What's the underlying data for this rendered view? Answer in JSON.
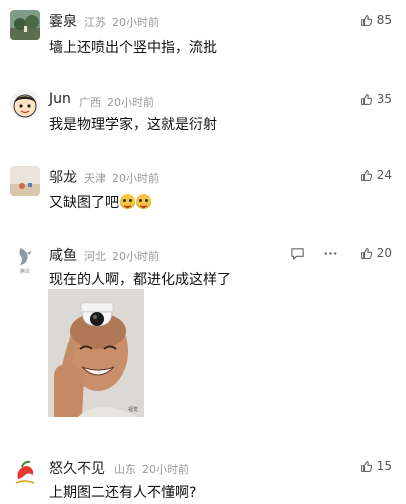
{
  "comments": [
    {
      "name": "霎泉",
      "region": "江苏",
      "time": "20小时前",
      "text": "墙上还喷出个竖中指，流批",
      "likes": "85"
    },
    {
      "name": "Jun",
      "region": "广西",
      "time": "20小时前",
      "text": "我是物理学家，这就是衍射",
      "likes": "35"
    },
    {
      "name": "邬龙",
      "region": "天津",
      "time": "20小时前",
      "text": "又缺图了吧",
      "likes": "24"
    },
    {
      "name": "咸鱼",
      "region": "河北",
      "time": "20小时前",
      "text": "现在的人啊，都进化成这样了",
      "likes": "20",
      "avatar_caption": "腾讯"
    },
    {
      "name": "怒久不见",
      "region": "山东",
      "time": "20小时前",
      "text": "上期图二还有人不懂啊?",
      "likes": "15"
    }
  ],
  "icons": {
    "like": "thumbs-up-icon",
    "reply": "comment-bubble-icon",
    "more": "more-dots-icon"
  },
  "colors": {
    "meta": "#999999",
    "text": "#111111"
  }
}
